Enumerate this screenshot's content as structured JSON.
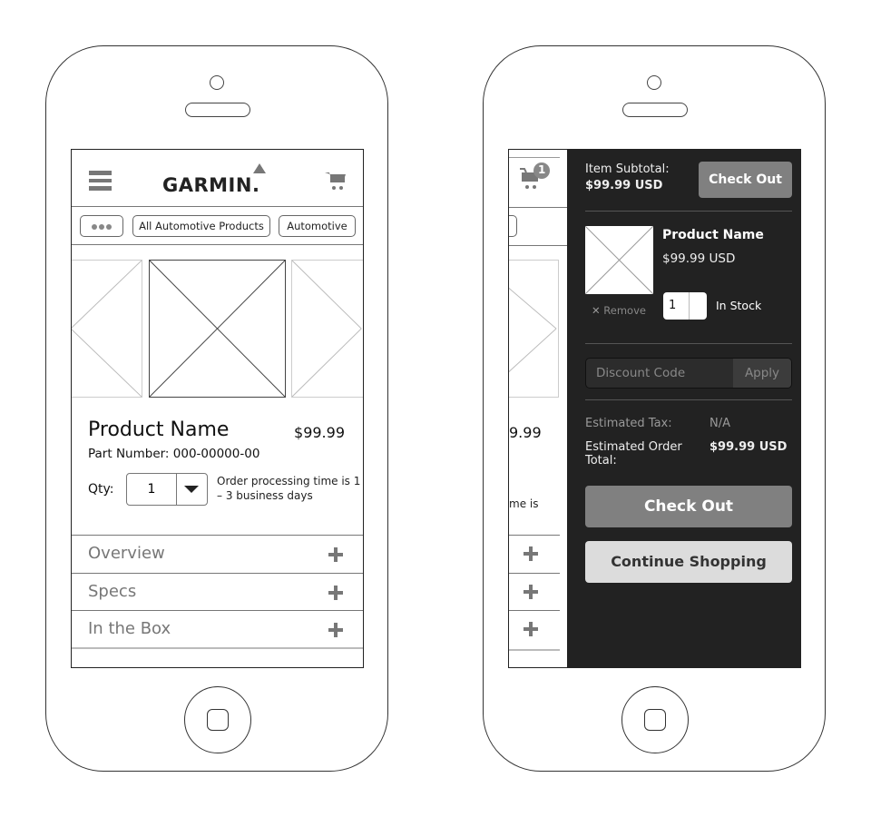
{
  "left_phone": {
    "header": {
      "logo_text": "GARMIN.",
      "menu_icon": "hamburger-menu-icon",
      "cart_icon": "shopping-cart-icon"
    },
    "breadcrumbs": {
      "more_icon": "ellipsis-icon",
      "items": [
        "All Automotive Products",
        "Automotive"
      ]
    },
    "product": {
      "name": "Product Name",
      "price": "$99.99",
      "part_number": "Part Number: 000-00000-00",
      "qty_label": "Qty:",
      "qty_value": "1",
      "processing_note": "Order processing time is 1 – 3 business days"
    },
    "accordion": [
      {
        "label": "Overview"
      },
      {
        "label": "Specs"
      },
      {
        "label": "In the Box"
      }
    ]
  },
  "right_phone": {
    "underlay": {
      "cart_badge": "1",
      "price_fragment": "9.99",
      "note_fragment": "me is"
    },
    "cart": {
      "subtotal_label": "Item Subtotal:",
      "subtotal_value": "$99.99 USD",
      "checkout_top_label": "Check Out",
      "item": {
        "name": "Product Name",
        "price": "$99.99 USD",
        "remove_label": "Remove",
        "qty_value": "1",
        "stock_status": "In Stock"
      },
      "discount": {
        "placeholder": "Discount Code",
        "apply_label": "Apply"
      },
      "tax_label": "Estimated Tax:",
      "tax_value": "N/A",
      "total_label": "Estimated Order Total:",
      "total_value": "$99.99 USD",
      "checkout_label": "Check Out",
      "continue_label": "Continue Shopping"
    }
  }
}
